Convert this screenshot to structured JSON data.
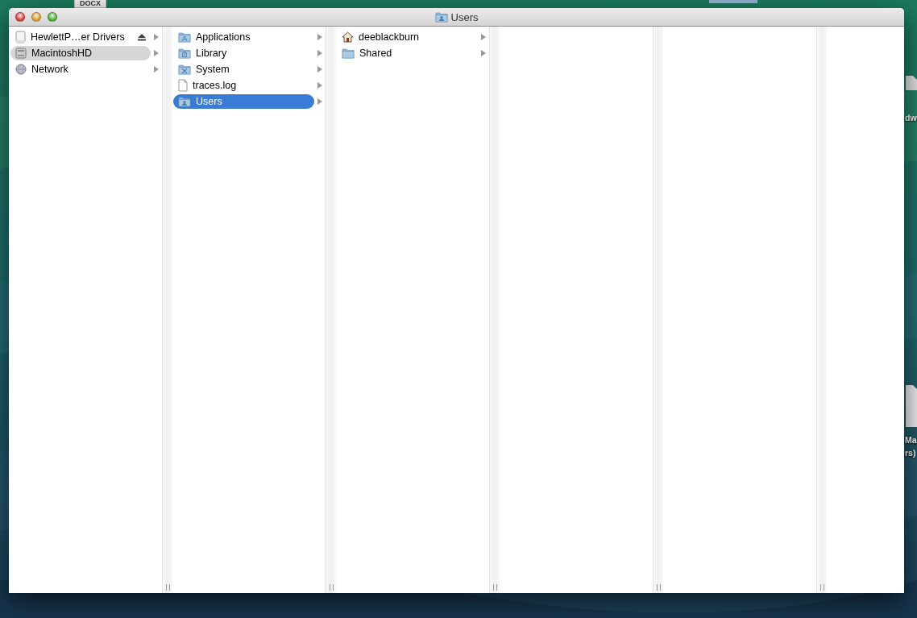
{
  "desktop_labels": [
    {
      "text": "DOCX",
      "kind": "tag"
    },
    {
      "text": "dw",
      "kind": "edge"
    },
    {
      "text": "Ma",
      "kind": "edge"
    },
    {
      "text": "rs)",
      "kind": "edge"
    }
  ],
  "window": {
    "title": "Users"
  },
  "columns": [
    {
      "kind": "sidebar",
      "focused": false,
      "items": [
        {
          "name": "HewlettP…er Drivers",
          "kind": "drive",
          "ejectable": true,
          "selected": false
        },
        {
          "name": "MacintoshHD",
          "kind": "disk",
          "ejectable": false,
          "selected": true
        },
        {
          "name": "Network",
          "kind": "globe",
          "ejectable": false,
          "selected": false
        }
      ]
    },
    {
      "kind": "list",
      "focused": true,
      "items": [
        {
          "name": "Applications",
          "kind": "apps",
          "selected": false
        },
        {
          "name": "Library",
          "kind": "library",
          "selected": false
        },
        {
          "name": "System",
          "kind": "system",
          "selected": false
        },
        {
          "name": "traces.log",
          "kind": "file",
          "selected": false
        },
        {
          "name": "Users",
          "kind": "users",
          "selected": true
        }
      ]
    },
    {
      "kind": "list",
      "items": [
        {
          "name": "deeblackburn",
          "kind": "home",
          "selected": false
        },
        {
          "name": "Shared",
          "kind": "folder",
          "selected": false
        }
      ]
    },
    {
      "kind": "list"
    },
    {
      "kind": "list"
    },
    {
      "kind": "list"
    }
  ]
}
